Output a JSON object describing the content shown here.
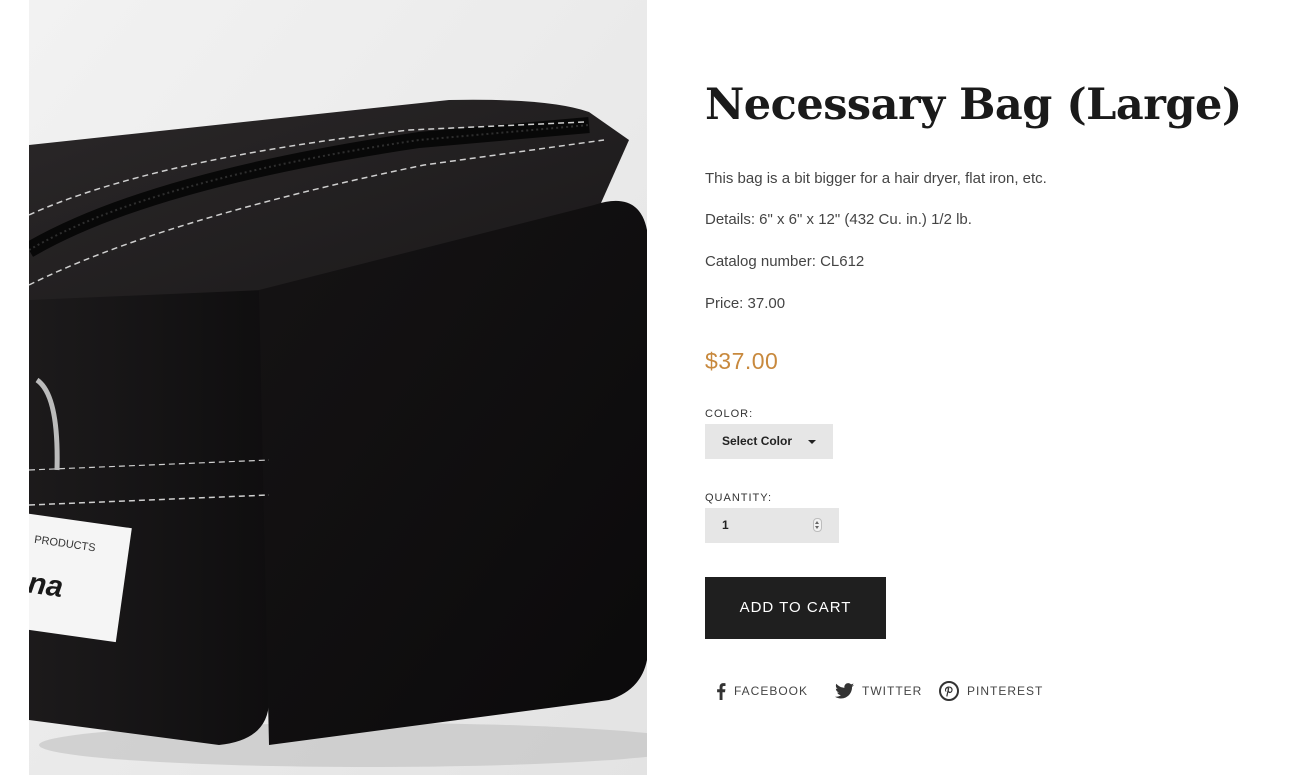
{
  "product": {
    "photo_alt": "Black canvas necessary bag",
    "title": "Necessary Bag (Large)",
    "description": [
      "This bag is a bit bigger for a hair dryer, flat iron, etc.",
      "Details: 6\" x 6\" x 12\" (432 Cu. in.) 1/2 lb.",
      "Catalog number: CL612",
      "Price: 37.00"
    ],
    "price": "$37.00",
    "price_color": "#c8893d"
  },
  "form": {
    "color_label": "COLOR:",
    "color_value": "Select Color",
    "quantity_label": "QUANTITY:",
    "quantity_value": "1",
    "add_to_cart": "ADD TO CART"
  },
  "share": {
    "facebook": "FACEBOOK",
    "twitter": "TWITTER",
    "pinterest": "PINTEREST"
  },
  "colors": {
    "text": "#333333",
    "button_bg": "#1f1f1f",
    "field_bg": "#e6e6e6"
  },
  "icons": [
    "facebook-icon",
    "twitter-icon",
    "pinterest-icon",
    "chevron-down-icon",
    "spinner-icon"
  ]
}
